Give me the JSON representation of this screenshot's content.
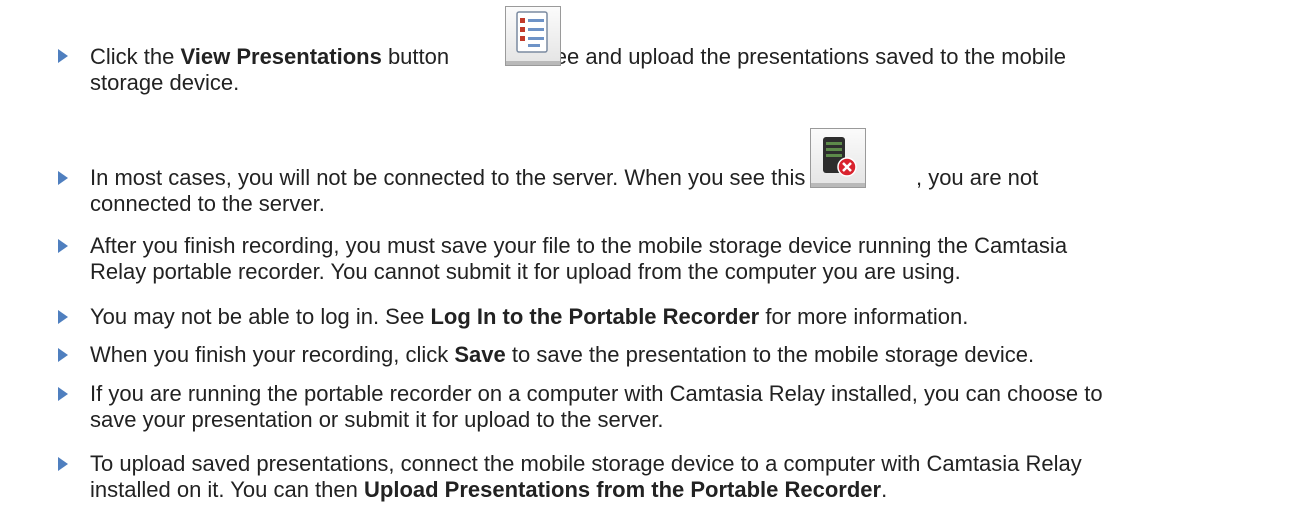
{
  "bullets": [
    {
      "pre": "Click the ",
      "bold1": "View Presentations",
      "mid": " button ",
      "post": " to see and upload the presentations saved to the mobile",
      "line2": "storage device."
    },
    {
      "pre": "In most cases, you will not be connected to the server. When you see this icon ",
      "post": ", you are not",
      "line2": "connected to the server."
    },
    {
      "line1": "After you finish recording, you must save your file to the mobile storage device running the Camtasia",
      "line2": "Relay portable recorder. You cannot submit it for upload from the computer you are using."
    },
    {
      "pre": "You may not be able to log in. See ",
      "bold1": "Log In to the Portable Recorder",
      "post": " for more information."
    },
    {
      "pre": "When you finish your recording, click ",
      "bold1": "Save",
      "post": " to save the presentation to the mobile storage device."
    },
    {
      "line1": "If you are running the portable recorder on a computer with Camtasia Relay installed, you can choose to",
      "line2": "save your presentation or submit it for upload to the server."
    },
    {
      "line1": "To upload saved presentations, connect the mobile storage device to a computer with Camtasia Relay",
      "pre2": "installed on it. You can then ",
      "bold2": "Upload Presentations from the Portable Recorder",
      "post2": "."
    }
  ],
  "icons": {
    "view_presentations": "view-presentations-icon",
    "server_disconnected": "server-disconnected-icon"
  },
  "colors": {
    "bullet_arrow": "#4f7fbf",
    "text": "#222222",
    "error_red": "#d9232e"
  }
}
